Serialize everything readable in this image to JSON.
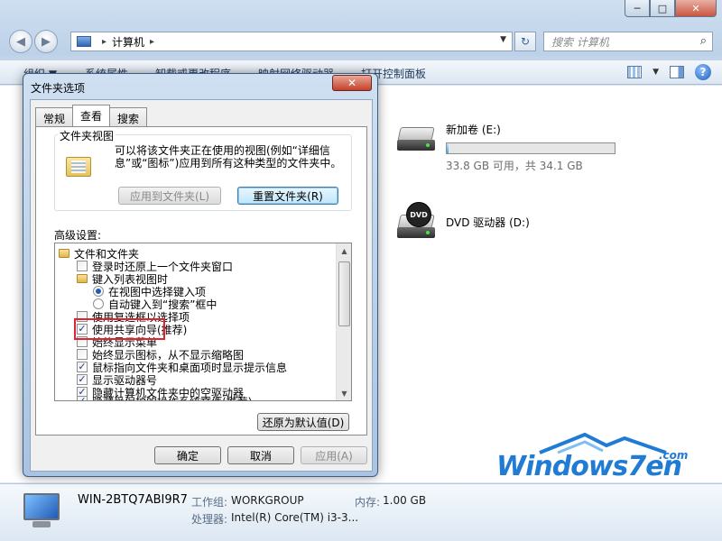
{
  "explorer": {
    "title_buttons": [
      "─",
      "□",
      "✕"
    ],
    "nav": {
      "back_glyph": "◀",
      "forward_glyph": "▶"
    },
    "address": {
      "separator": "▸",
      "location": "计算机",
      "trailing_separator": "▸",
      "dropdown_glyph": "▼"
    },
    "refresh_glyph": "↻",
    "search": {
      "placeholder": "搜索 计算机",
      "icon_glyph": "⌕"
    },
    "command_bar": [
      "组织 ▼",
      "系统属性",
      "卸载或更改程序",
      "映射网络驱动器",
      "打开控制面板"
    ],
    "view_dropdown_glyph": "▼",
    "help_glyph": "?",
    "drives": [
      {
        "name": "新加卷 (E:)",
        "capacity_text": "33.8 GB 可用，共 34.1 GB",
        "used_fraction": 0.01
      },
      {
        "name": "DVD 驱动器 (D:)",
        "badge": "DVD"
      }
    ],
    "details": {
      "computer_name": "WIN-2BTQ7ABI9R7",
      "workgroup_label": "工作组:",
      "workgroup": "WORKGROUP",
      "memory_label": "内存:",
      "memory": "1.00 GB",
      "cpu_label": "处理器:",
      "cpu": "Intel(R) Core(TM) i3-3..."
    }
  },
  "dialog": {
    "title": "文件夹选项",
    "close_glyph": "✕",
    "tabs": [
      "常规",
      "查看",
      "搜索"
    ],
    "active_tab": "查看",
    "folder_views": {
      "label": "文件夹视图",
      "description": "可以将该文件夹正在使用的视图(例如“详细信息”或“图标”)应用到所有这种类型的文件夹中。",
      "apply_button": "应用到文件夹(L)",
      "reset_button": "重置文件夹(R)"
    },
    "advanced_label": "高级设置:",
    "advanced_items": [
      {
        "type": "folder",
        "label": "文件和文件夹",
        "level": 0
      },
      {
        "type": "checkbox",
        "label": "登录时还原上一个文件夹窗口",
        "checked": false,
        "level": 1
      },
      {
        "type": "folder",
        "label": "键入列表视图时",
        "level": 1
      },
      {
        "type": "radio",
        "label": "在视图中选择键入项",
        "checked": true,
        "level": 2
      },
      {
        "type": "radio",
        "label": "自动键入到“搜索”框中",
        "checked": false,
        "level": 2
      },
      {
        "type": "checkbox",
        "label": "使用复选框以选择项",
        "checked": false,
        "level": 1
      },
      {
        "type": "checkbox",
        "label": "使用共享向导(推荐)",
        "checked": true,
        "level": 1
      },
      {
        "type": "checkbox",
        "label": "始终显示菜单",
        "checked": false,
        "level": 1
      },
      {
        "type": "checkbox",
        "label": "始终显示图标，从不显示缩略图",
        "checked": false,
        "level": 1
      },
      {
        "type": "checkbox",
        "label": "鼠标指向文件夹和桌面项时显示提示信息",
        "checked": true,
        "level": 1
      },
      {
        "type": "checkbox",
        "label": "显示驱动器号",
        "checked": true,
        "level": 1
      },
      {
        "type": "checkbox",
        "label": "隐藏计算机文件夹中的空驱动器",
        "checked": true,
        "level": 1
      },
      {
        "type": "checkbox",
        "label": "隐藏受保护的操作系统文件(推荐)",
        "checked": true,
        "level": 1
      }
    ],
    "check_glyph": "✓",
    "scroll_up_glyph": "▲",
    "scroll_down_glyph": "▼",
    "restore_defaults_button": "还原为默认值(D)",
    "ok_button": "确定",
    "cancel_button": "取消",
    "apply_button": "应用(A)"
  },
  "watermark": {
    "brand": "Windows7en",
    "suffix": ".com"
  },
  "colors": {
    "highlight_box": "#e0232d",
    "watermark_blue": "#1f7bd4",
    "capacity_fill": "#36a8e0"
  }
}
